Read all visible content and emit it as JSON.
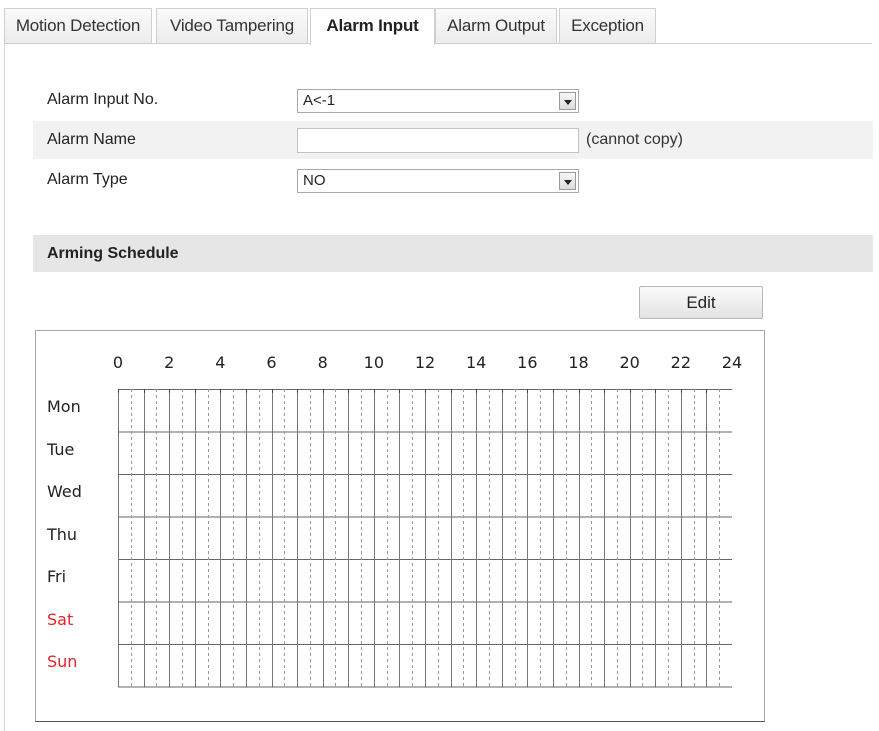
{
  "tabs": [
    {
      "label": "Motion Detection",
      "active": false
    },
    {
      "label": "Video Tampering",
      "active": false
    },
    {
      "label": "Alarm Input",
      "active": true
    },
    {
      "label": "Alarm Output",
      "active": false
    },
    {
      "label": "Exception",
      "active": false
    }
  ],
  "form": {
    "alarm_input_no": {
      "label": "Alarm Input No.",
      "value": "A<-1"
    },
    "alarm_name": {
      "label": "Alarm Name",
      "value": "",
      "hint": "(cannot copy)"
    },
    "alarm_type": {
      "label": "Alarm Type",
      "value": "NO"
    }
  },
  "arming_schedule": {
    "title": "Arming Schedule",
    "edit_label": "Edit",
    "hour_labels": [
      "0",
      "2",
      "4",
      "6",
      "8",
      "10",
      "12",
      "14",
      "16",
      "18",
      "20",
      "22",
      "24"
    ],
    "days": [
      {
        "label": "Mon",
        "weekend": false
      },
      {
        "label": "Tue",
        "weekend": false
      },
      {
        "label": "Wed",
        "weekend": false
      },
      {
        "label": "Thu",
        "weekend": false
      },
      {
        "label": "Fri",
        "weekend": false
      },
      {
        "label": "Sat",
        "weekend": true
      },
      {
        "label": "Sun",
        "weekend": true
      }
    ]
  },
  "colors": {
    "weekend_text": "#e0242b",
    "section_header_bg": "#e6e6e6",
    "row_shade": "#f2f2f2"
  }
}
